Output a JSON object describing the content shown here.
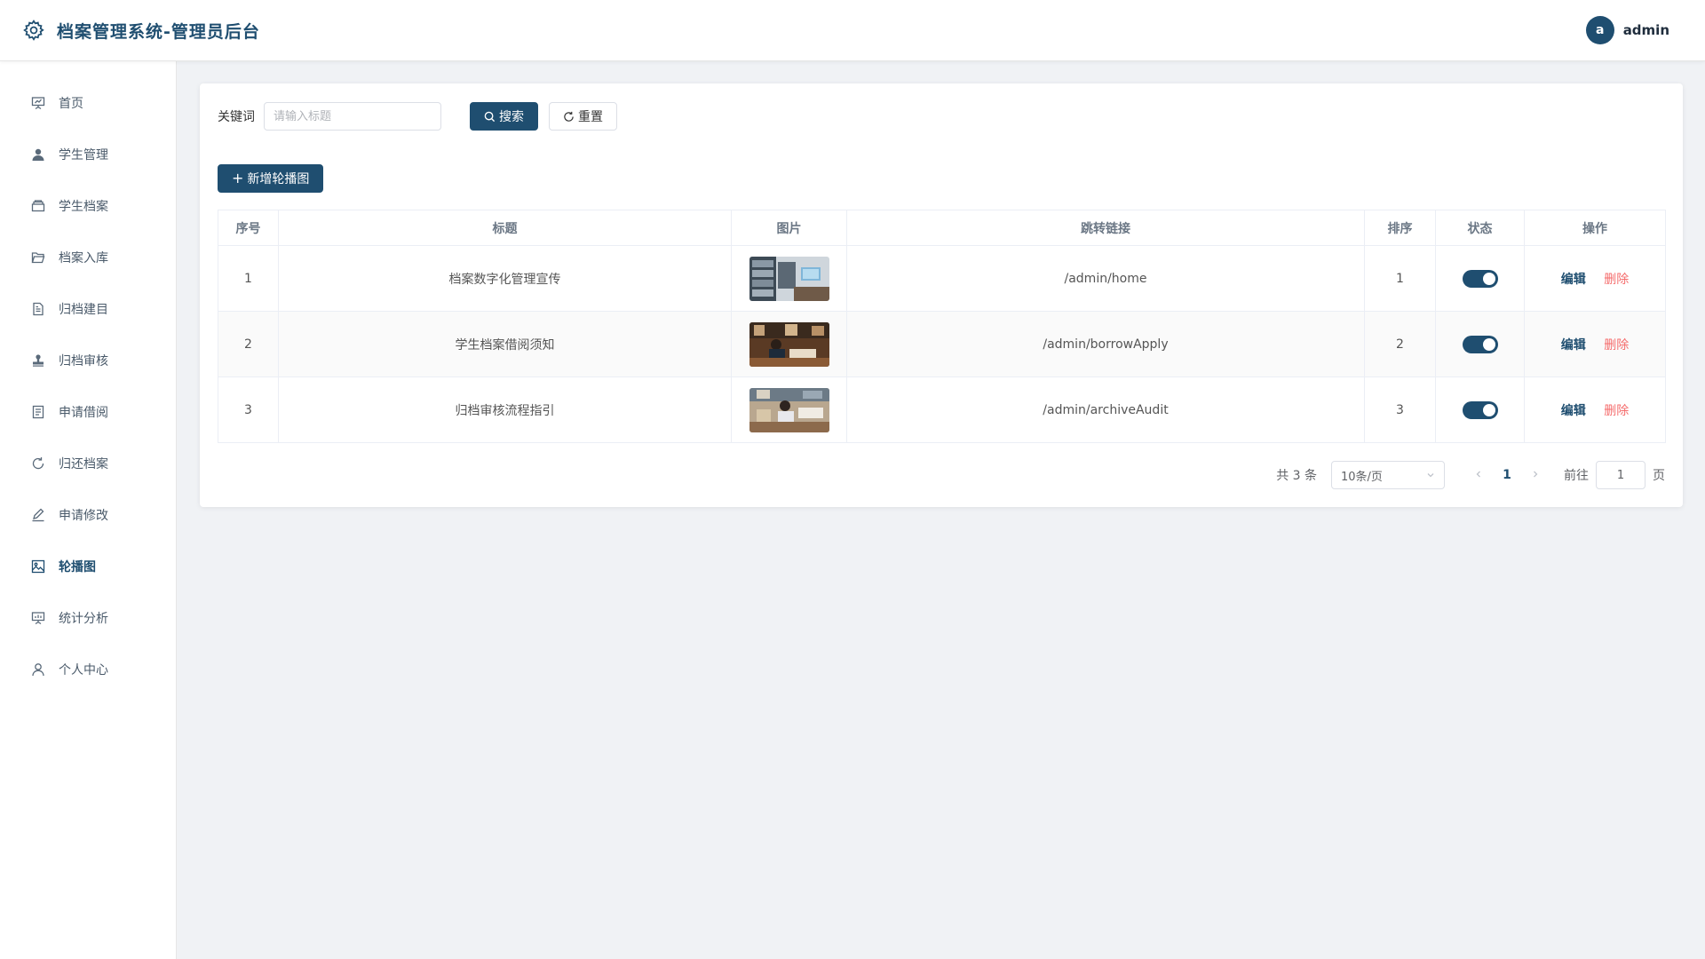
{
  "header": {
    "title": "档案管理系统-管理员后台",
    "avatar_letter": "a",
    "username": "admin"
  },
  "sidebar": {
    "items": [
      {
        "label": "首页",
        "icon": "presentation-icon",
        "active": false
      },
      {
        "label": "学生管理",
        "icon": "user-filled-icon",
        "active": false
      },
      {
        "label": "学生档案",
        "icon": "box-icon",
        "active": false
      },
      {
        "label": "档案入库",
        "icon": "folder-open-icon",
        "active": false
      },
      {
        "label": "归档建目",
        "icon": "document-icon",
        "active": false
      },
      {
        "label": "归档审核",
        "icon": "stamp-icon",
        "active": false
      },
      {
        "label": "申请借阅",
        "icon": "tickets-icon",
        "active": false
      },
      {
        "label": "归还档案",
        "icon": "refresh-icon",
        "active": false
      },
      {
        "label": "申请修改",
        "icon": "edit-pen-icon",
        "active": false
      },
      {
        "label": "轮播图",
        "icon": "picture-icon",
        "active": true
      },
      {
        "label": "统计分析",
        "icon": "data-board-icon",
        "active": false
      },
      {
        "label": "个人中心",
        "icon": "user-icon",
        "active": false
      }
    ]
  },
  "search": {
    "label": "关键词",
    "placeholder": "请输入标题",
    "value": "",
    "search_button": "搜索",
    "reset_button": "重置"
  },
  "toolbar": {
    "add_button": "新增轮播图"
  },
  "table": {
    "headers": [
      "序号",
      "标题",
      "图片",
      "跳转链接",
      "排序",
      "状态",
      "操作"
    ],
    "rows": [
      {
        "index": "1",
        "title": "档案数字化管理宣传",
        "link": "/admin/home",
        "sort": "1",
        "status": true,
        "edit": "编辑",
        "delete": "删除"
      },
      {
        "index": "2",
        "title": "学生档案借阅须知",
        "link": "/admin/borrowApply",
        "sort": "2",
        "status": true,
        "edit": "编辑",
        "delete": "删除"
      },
      {
        "index": "3",
        "title": "归档审核流程指引",
        "link": "/admin/archiveAudit",
        "sort": "3",
        "status": true,
        "edit": "编辑",
        "delete": "删除"
      }
    ]
  },
  "pagination": {
    "total": "共 3 条",
    "page_size": "10条/页",
    "current_page": "1",
    "goto_label": "前往",
    "goto_value": "1",
    "goto_suffix": "页"
  },
  "colors": {
    "primary": "#1f4e70",
    "danger": "#f56c6c",
    "background": "#f0f2f5"
  }
}
